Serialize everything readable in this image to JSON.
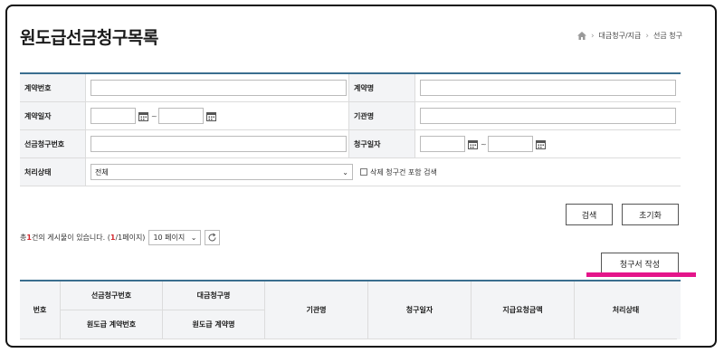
{
  "page": {
    "title": "원도급선금청구목록",
    "breadcrumb": [
      "대금청구/지급",
      "선금 청구"
    ]
  },
  "search": {
    "contract_no_label": "계약번호",
    "contract_name_label": "계약명",
    "contract_date_label": "계약일자",
    "agency_label": "기관명",
    "advance_claim_no_label": "선금청구번호",
    "claim_date_label": "청구일자",
    "status_label": "처리상태",
    "status_value": "전체",
    "include_deleted_label": "삭제 청구건 포함 검색",
    "tilde": "~",
    "search_button": "검색",
    "reset_button": "초기화"
  },
  "list": {
    "count_prefix": "총 ",
    "count": "1",
    "count_suffix": "건의 게시물이 있습니다. (",
    "page_current": "1",
    "page_total": " /1페이지)",
    "page_size": "10 페이지",
    "write_button": "청구서 작성"
  },
  "table": {
    "headers": {
      "no": "번호",
      "advance_claim_no": "선금청구번호",
      "prime_contract_no": "원도급 계약번호",
      "payment_claim_name": "대금청구명",
      "prime_contract_name": "원도급 계약명",
      "agency": "기관명",
      "claim_date": "청구일자",
      "requested_amount": "지급요청금액",
      "status": "처리상태"
    }
  },
  "colors": {
    "accent_border": "#3a6e8f",
    "count_red": "#d2282e",
    "highlight_magenta": "#e4158a",
    "label_bg": "#f3f4f6"
  },
  "icons": [
    "home-icon",
    "calendar-icon",
    "chevron-down-icon",
    "refresh-icon",
    "checkbox-icon"
  ]
}
